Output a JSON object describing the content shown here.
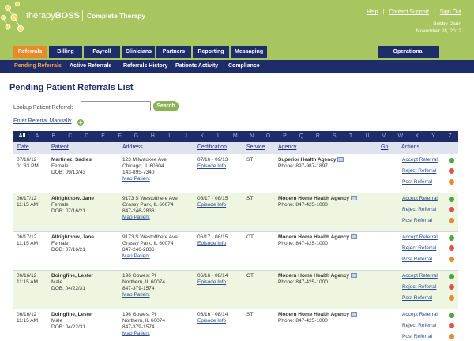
{
  "header": {
    "brand_thin": "therapy",
    "brand_bold": "BOSS",
    "product": "Complete Therapy",
    "links": [
      "Help",
      "Contact Support",
      "Sign Out"
    ],
    "user_name": "Bobby Darin",
    "date": "November 28, 2012"
  },
  "tabs": [
    "Referrals",
    "Billing",
    "Payroll",
    "Clinicians",
    "Partners",
    "Reporting",
    "Messaging"
  ],
  "operational_settings": "Operational Settings",
  "subnav": [
    "Pending Referrals",
    "Active Referrals",
    "Referrals History",
    "Patients Activity",
    "Compliance"
  ],
  "page_title": "Pending Patient Referrals List",
  "lookup": {
    "label": "Lookup Patient Referral:",
    "value": "",
    "button": "Search"
  },
  "enter_manually": "Enter Referral Manually",
  "letters": [
    "All",
    "A",
    "B",
    "C",
    "D",
    "E",
    "F",
    "G",
    "H",
    "I",
    "J",
    "K",
    "L",
    "M",
    "N",
    "O",
    "P",
    "Q",
    "R",
    "S",
    "T",
    "U",
    "V",
    "W",
    "X",
    "Y",
    "Z"
  ],
  "columns": [
    "Date",
    "Patient",
    "Address",
    "Certification",
    "Service",
    "Agency",
    "Go",
    "Actions"
  ],
  "actions": [
    "Accept Referral",
    "Reject Referral",
    "Post Referral"
  ],
  "episode_label": "Episode Info",
  "map_label": "Map Patient",
  "rows": [
    {
      "date": "07/16/12",
      "time": "01:33 PM",
      "name": "Martinez, Sadies",
      "gender": "Female",
      "dob": "DOB: 09/13/43",
      "addr1": "123 Milwaukee Ave",
      "addr2": "Chicago, IL 60604",
      "phone": "143-895-7340",
      "cert": "07/16 - 09/13",
      "service": "ST",
      "agency": "Superior Health Agency",
      "agency_phone": "Phone: 897-987-1897"
    },
    {
      "date": "06/17/12",
      "time": "11:15 AM",
      "name": "Allrightnow, Jane",
      "gender": "Female",
      "dob": "DOB: 07/16/21",
      "addr1": "9173 S Westofthere Ave",
      "addr2": "Grassy Park, IL 60074",
      "phone": "847-246-2836",
      "cert": "06/17 - 08/15",
      "service": "ST",
      "agency": "Modern Home Health Agency",
      "agency_phone": "Phone: 847-425-1000"
    },
    {
      "date": "06/17/12",
      "time": "11:15 AM",
      "name": "Allrightnow, Jane",
      "gender": "Female",
      "dob": "DOB: 07/16/21",
      "addr1": "9173 S Westofthere Ave",
      "addr2": "Grassy Park, IL 60074",
      "phone": "847-246-2836",
      "cert": "06/17 - 08/15",
      "service": "OT",
      "agency": "Modern Home Health Agency",
      "agency_phone": "Phone: 847-425-1000"
    },
    {
      "date": "06/16/12",
      "time": "11:15 AM",
      "name": "Doingfine, Lester",
      "gender": "Male",
      "dob": "DOB: 04/22/31",
      "addr1": "196 Gowest Pl",
      "addr2": "Northern, IL 60074",
      "phone": "847-379-1574",
      "cert": "06/16 - 08/14",
      "service": "OT",
      "agency": "Modern Home Health Agency",
      "agency_phone": "Phone: 847-425-1000"
    },
    {
      "date": "06/16/12",
      "time": "11:15 AM",
      "name": "Doingfine, Lester",
      "gender": "Male",
      "dob": "DOB: 04/22/31",
      "addr1": "196 Gowest Pl",
      "addr2": "Northern, IL 60074",
      "phone": "847-379-1574",
      "cert": "06/16 - 08/14",
      "service": "ST",
      "agency": "Modern Home Health Agency",
      "agency_phone": "Phone: 847-425-1000"
    }
  ]
}
